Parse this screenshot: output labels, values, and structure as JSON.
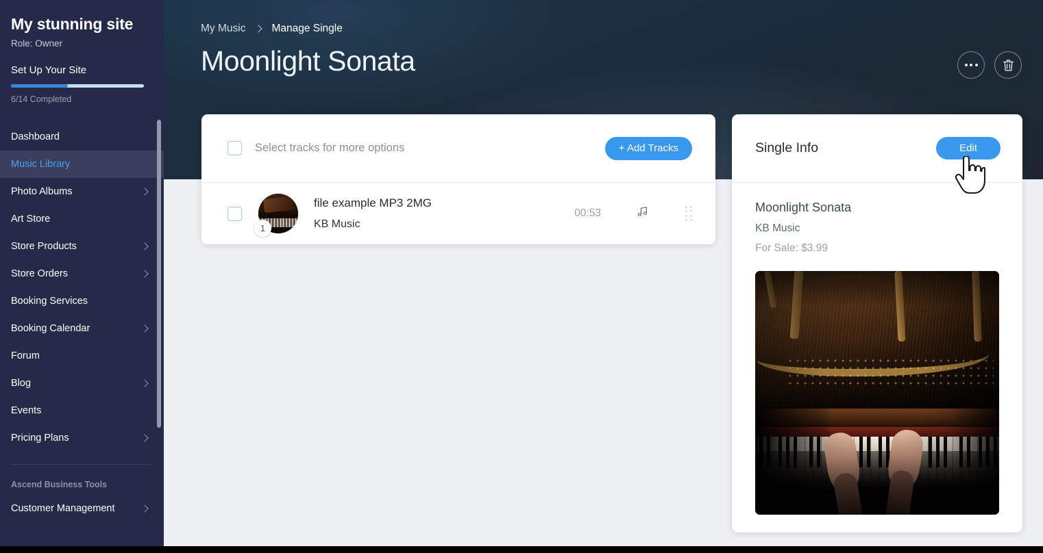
{
  "sidebar": {
    "site_title": "My stunning site",
    "role": "Role: Owner",
    "setup_title": "Set Up Your Site",
    "progress_label": "6/14 Completed",
    "progress_percent": 43,
    "accent_color": "#3d85d8",
    "items": [
      {
        "label": "Dashboard",
        "chevron": false,
        "active": false
      },
      {
        "label": "Music Library",
        "chevron": false,
        "active": true
      },
      {
        "label": "Photo Albums",
        "chevron": true,
        "active": false
      },
      {
        "label": "Art Store",
        "chevron": false,
        "active": false
      },
      {
        "label": "Store Products",
        "chevron": true,
        "active": false
      },
      {
        "label": "Store Orders",
        "chevron": true,
        "active": false
      },
      {
        "label": "Booking Services",
        "chevron": false,
        "active": false
      },
      {
        "label": "Booking Calendar",
        "chevron": true,
        "active": false
      },
      {
        "label": "Forum",
        "chevron": false,
        "active": false
      },
      {
        "label": "Blog",
        "chevron": true,
        "active": false
      },
      {
        "label": "Events",
        "chevron": false,
        "active": false
      },
      {
        "label": "Pricing Plans",
        "chevron": true,
        "active": false
      }
    ],
    "section_label": "Ascend Business Tools",
    "section_items": [
      {
        "label": "Customer Management",
        "chevron": true,
        "active": false
      }
    ]
  },
  "header": {
    "breadcrumb": [
      {
        "label": "My Music",
        "current": false
      },
      {
        "label": "Manage Single",
        "current": true
      }
    ],
    "title": "Moonlight Sonata",
    "more_icon": "more-horizontal-icon",
    "delete_icon": "trash-icon"
  },
  "tracks_panel": {
    "select_label": "Select tracks for more options",
    "select_checked": false,
    "add_tracks_label": "+ Add Tracks",
    "columns": [
      "title",
      "artist",
      "duration"
    ],
    "rows": [
      {
        "index": "1",
        "title": "file example MP3 2MG",
        "artist": "KB Music",
        "duration": "00:53",
        "checked": false,
        "type_icon": "music-note-icon",
        "drag_icon": "drag-handle-icon"
      }
    ]
  },
  "info_panel": {
    "title": "Single Info",
    "edit_label": "Edit",
    "single_name": "Moonlight Sonata",
    "artist": "KB Music",
    "price_label": "For Sale: $3.99",
    "cover_alt": "grand-piano-cover-art"
  },
  "theme": {
    "brand_blue": "#3899ec",
    "sidebar_bg": "#252a48",
    "sidebar_active_bg": "#3a3f5e",
    "sidebar_active_text": "#4a9ef0",
    "content_bg": "#eef0f4",
    "header_gradient_from": "#1b3246",
    "header_gradient_to": "#1d2630"
  }
}
